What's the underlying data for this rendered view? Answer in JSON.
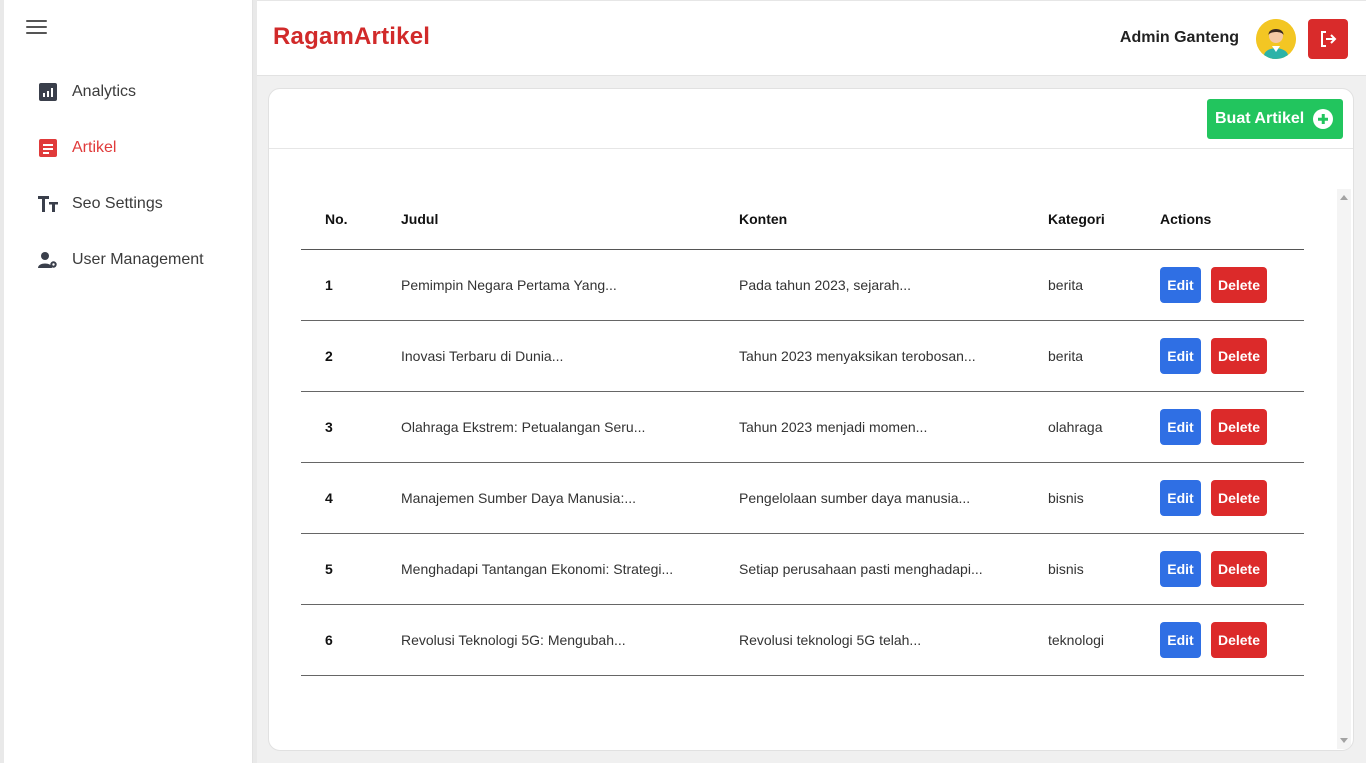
{
  "sidebar": {
    "items": [
      {
        "label": "Analytics",
        "icon": "analytics-icon"
      },
      {
        "label": "Artikel",
        "icon": "article-icon",
        "active": true
      },
      {
        "label": "Seo Settings",
        "icon": "text-size-icon"
      },
      {
        "label": "User Management",
        "icon": "user-settings-icon"
      }
    ]
  },
  "header": {
    "brand": "RagamArtikel",
    "user_name": "Admin Ganteng"
  },
  "toolbar": {
    "create_label": "Buat Artikel"
  },
  "table": {
    "headers": [
      "No.",
      "Judul",
      "Konten",
      "Kategori",
      "Actions"
    ],
    "rows": [
      {
        "no": "1",
        "judul": "Pemimpin Negara Pertama Yang...",
        "konten": "Pada tahun 2023, sejarah...",
        "kategori": "berita"
      },
      {
        "no": "2",
        "judul": "Inovasi Terbaru di Dunia...",
        "konten": "Tahun 2023 menyaksikan terobosan...",
        "kategori": "berita"
      },
      {
        "no": "3",
        "judul": "Olahraga Ekstrem: Petualangan Seru...",
        "konten": "Tahun 2023 menjadi momen...",
        "kategori": "olahraga"
      },
      {
        "no": "4",
        "judul": "Manajemen Sumber Daya Manusia:...",
        "konten": "Pengelolaan sumber daya manusia...",
        "kategori": "bisnis"
      },
      {
        "no": "5",
        "judul": "Menghadapi Tantangan Ekonomi: Strategi...",
        "konten": "Setiap perusahaan pasti menghadapi...",
        "kategori": "bisnis"
      },
      {
        "no": "6",
        "judul": "Revolusi Teknologi 5G: Mengubah...",
        "konten": "Revolusi teknologi 5G telah...",
        "kategori": "teknologi"
      }
    ],
    "edit_label": "Edit",
    "delete_label": "Delete"
  },
  "colors": {
    "brand": "#d12a2a",
    "active_nav": "#e03a3a",
    "create_button": "#22c55e",
    "edit_button": "#2f6fe4",
    "delete_button": "#dc2a2a"
  }
}
